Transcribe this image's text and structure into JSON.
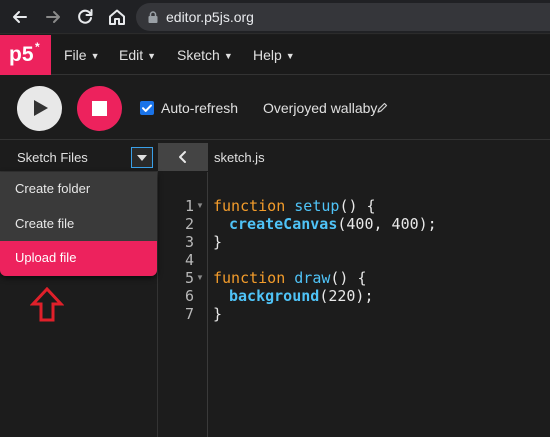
{
  "browser": {
    "url": "editor.p5js.org",
    "nav_icons": [
      "back-arrow-icon",
      "forward-arrow-icon",
      "reload-icon",
      "home-icon",
      "lock-icon"
    ]
  },
  "app": {
    "logo_text": "p5",
    "logo_star": "*",
    "brand_color": "#ed225d"
  },
  "menu": {
    "file": "File",
    "edit": "Edit",
    "sketch": "Sketch",
    "help": "Help"
  },
  "toolbar": {
    "auto_refresh_label": "Auto-refresh",
    "auto_refresh_checked": true,
    "sketch_name": "Overjoyed wallaby"
  },
  "sidebar": {
    "title": "Sketch Files",
    "dropdown": [
      {
        "label": "Create folder"
      },
      {
        "label": "Create file"
      },
      {
        "label": "Upload file",
        "active": true
      }
    ]
  },
  "editor": {
    "tab": "sketch.js",
    "lines": [
      {
        "n": "1",
        "fold": true
      },
      {
        "n": "2",
        "fold": false
      },
      {
        "n": "3",
        "fold": false
      },
      {
        "n": "4",
        "fold": false
      },
      {
        "n": "5",
        "fold": true
      },
      {
        "n": "6",
        "fold": false
      },
      {
        "n": "7",
        "fold": false
      }
    ],
    "code": {
      "l1_kw": "function",
      "l1_fn": "setup",
      "l1_rest": "() {",
      "l2_fn": "createCanvas",
      "l2_rest": "(400, 400);",
      "l3": "}",
      "l5_kw": "function",
      "l5_fn": "draw",
      "l5_rest": "() {",
      "l6_fn": "background",
      "l6_rest": "(220);",
      "l7": "}"
    }
  },
  "annotation": {
    "arrow_color": "#e0202a"
  }
}
